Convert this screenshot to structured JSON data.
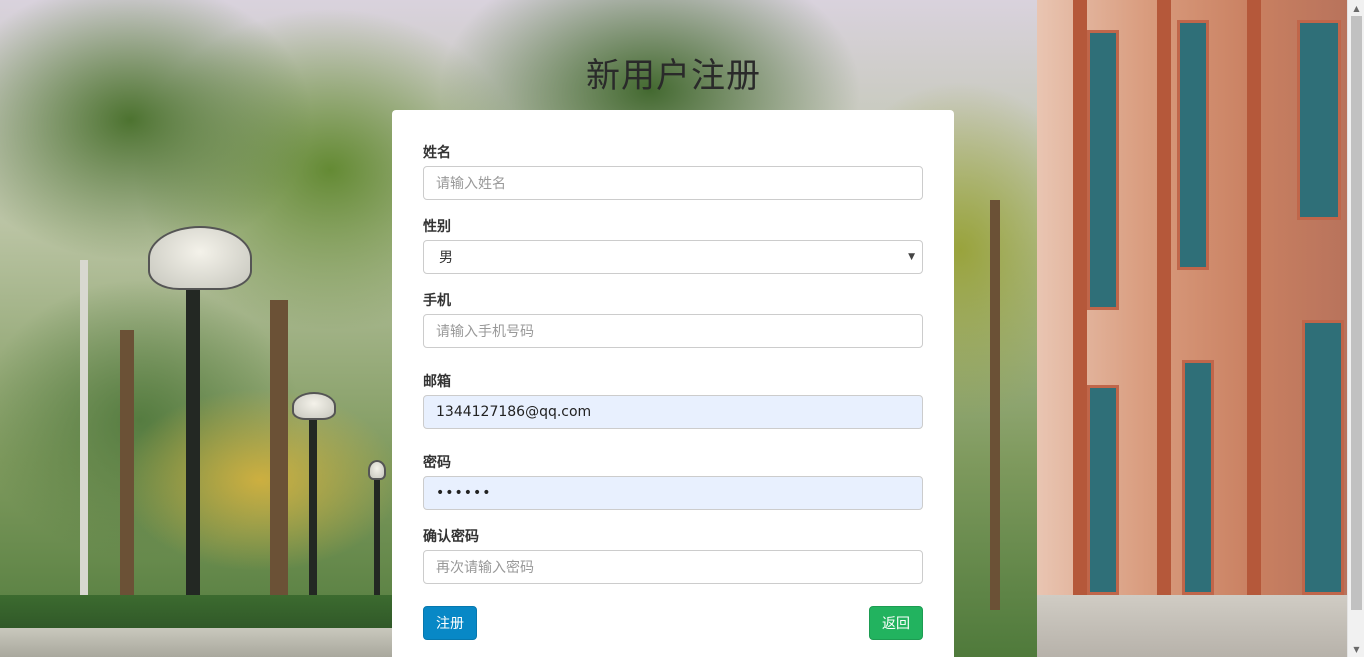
{
  "page": {
    "title": "新用户注册"
  },
  "form": {
    "name": {
      "label": "姓名",
      "placeholder": "请输入姓名",
      "value": ""
    },
    "gender": {
      "label": "性别",
      "selected": "男"
    },
    "phone": {
      "label": "手机",
      "placeholder": "请输入手机号码",
      "value": ""
    },
    "email": {
      "label": "邮箱",
      "value": "1344127186@qq.com"
    },
    "password": {
      "label": "密码",
      "masked_value": "••••••"
    },
    "confirm_password": {
      "label": "确认密码",
      "placeholder": "再次请输入密码",
      "value": ""
    }
  },
  "buttons": {
    "register": "注册",
    "back": "返回"
  },
  "colors": {
    "primary_button": "#0888c6",
    "success_button": "#22b35f",
    "autofill_bg": "#e8f0fe"
  },
  "icons": {
    "select_arrow": "chevron-down-icon",
    "scroll_up": "scroll-up-arrow-icon",
    "scroll_down": "scroll-down-arrow-icon"
  }
}
